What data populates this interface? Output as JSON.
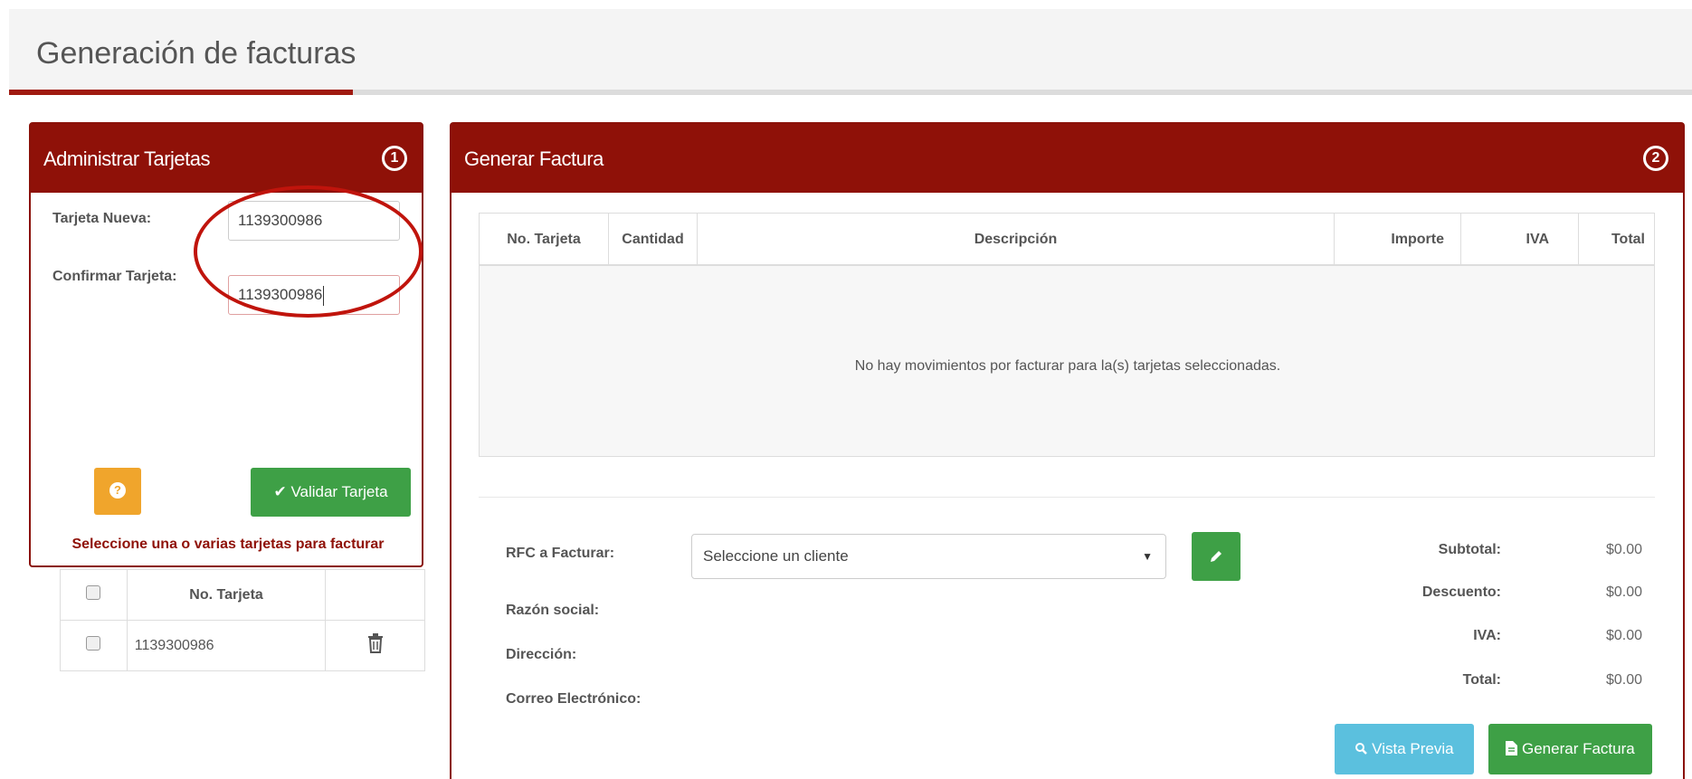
{
  "page": {
    "title": "Generación de facturas"
  },
  "left_panel": {
    "title": "Administrar Tarjetas",
    "step": "1",
    "new_card_label": "Tarjeta Nueva:",
    "new_card_value": "1139300986",
    "confirm_label": "Confirmar Tarjeta:",
    "confirm_value": "1139300986",
    "help_icon": "question-circle-icon",
    "validate_icon": "✔",
    "validate_label": "Validar Tarjeta",
    "hint": "Seleccione una o varias tarjetas para facturar",
    "table_header": "No. Tarjeta",
    "cards": [
      {
        "number": "1139300986"
      }
    ],
    "delete_icon": "trash-icon"
  },
  "right_panel": {
    "title": "Generar Factura",
    "step": "2",
    "columns": [
      "No. Tarjeta",
      "Cantidad",
      "Descripción",
      "Importe",
      "IVA",
      "Total"
    ],
    "empty_message": "No hay movimientos por facturar para la(s) tarjetas seleccionadas.",
    "rfc_label": "RFC a Facturar:",
    "rfc_placeholder": "Seleccione un cliente",
    "razon_label": "Razón social:",
    "direccion_label": "Dirección:",
    "correo_label": "Correo Electrónico:",
    "totals": [
      {
        "label": "Subtotal:",
        "value": "$0.00"
      },
      {
        "label": "Descuento:",
        "value": "$0.00"
      },
      {
        "label": "IVA:",
        "value": "$0.00"
      },
      {
        "label": "Total:",
        "value": "$0.00"
      }
    ],
    "preview_label": "Vista Previa",
    "generate_label": "Generar Factura"
  },
  "colors": {
    "brand": "#8f1108",
    "success": "#3ea046",
    "info": "#5bc0de",
    "warning": "#f0a52c"
  }
}
